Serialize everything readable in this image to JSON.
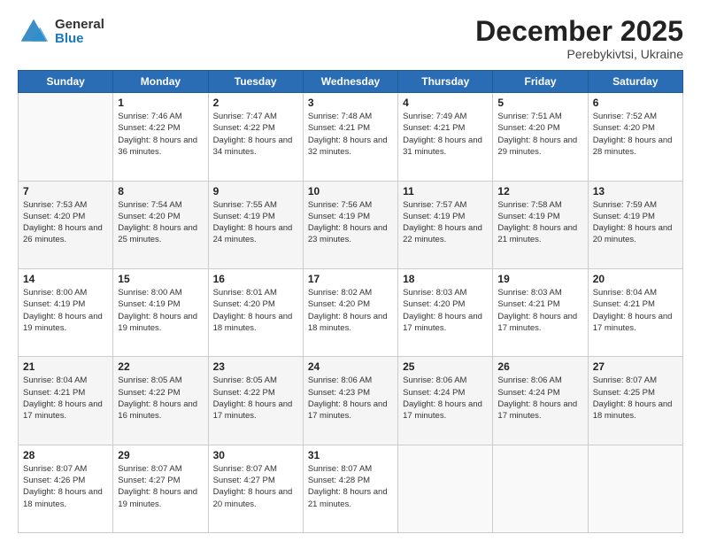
{
  "header": {
    "logo_general": "General",
    "logo_blue": "Blue",
    "month_title": "December 2025",
    "location": "Perebykivtsi, Ukraine"
  },
  "days_of_week": [
    "Sunday",
    "Monday",
    "Tuesday",
    "Wednesday",
    "Thursday",
    "Friday",
    "Saturday"
  ],
  "weeks": [
    [
      {
        "day": "",
        "empty": true
      },
      {
        "day": "1",
        "sunrise": "7:46 AM",
        "sunset": "4:22 PM",
        "daylight": "8 hours and 36 minutes."
      },
      {
        "day": "2",
        "sunrise": "7:47 AM",
        "sunset": "4:22 PM",
        "daylight": "8 hours and 34 minutes."
      },
      {
        "day": "3",
        "sunrise": "7:48 AM",
        "sunset": "4:21 PM",
        "daylight": "8 hours and 32 minutes."
      },
      {
        "day": "4",
        "sunrise": "7:49 AM",
        "sunset": "4:21 PM",
        "daylight": "8 hours and 31 minutes."
      },
      {
        "day": "5",
        "sunrise": "7:51 AM",
        "sunset": "4:20 PM",
        "daylight": "8 hours and 29 minutes."
      },
      {
        "day": "6",
        "sunrise": "7:52 AM",
        "sunset": "4:20 PM",
        "daylight": "8 hours and 28 minutes."
      }
    ],
    [
      {
        "day": "7",
        "sunrise": "7:53 AM",
        "sunset": "4:20 PM",
        "daylight": "8 hours and 26 minutes."
      },
      {
        "day": "8",
        "sunrise": "7:54 AM",
        "sunset": "4:20 PM",
        "daylight": "8 hours and 25 minutes."
      },
      {
        "day": "9",
        "sunrise": "7:55 AM",
        "sunset": "4:19 PM",
        "daylight": "8 hours and 24 minutes."
      },
      {
        "day": "10",
        "sunrise": "7:56 AM",
        "sunset": "4:19 PM",
        "daylight": "8 hours and 23 minutes."
      },
      {
        "day": "11",
        "sunrise": "7:57 AM",
        "sunset": "4:19 PM",
        "daylight": "8 hours and 22 minutes."
      },
      {
        "day": "12",
        "sunrise": "7:58 AM",
        "sunset": "4:19 PM",
        "daylight": "8 hours and 21 minutes."
      },
      {
        "day": "13",
        "sunrise": "7:59 AM",
        "sunset": "4:19 PM",
        "daylight": "8 hours and 20 minutes."
      }
    ],
    [
      {
        "day": "14",
        "sunrise": "8:00 AM",
        "sunset": "4:19 PM",
        "daylight": "8 hours and 19 minutes."
      },
      {
        "day": "15",
        "sunrise": "8:00 AM",
        "sunset": "4:19 PM",
        "daylight": "8 hours and 19 minutes."
      },
      {
        "day": "16",
        "sunrise": "8:01 AM",
        "sunset": "4:20 PM",
        "daylight": "8 hours and 18 minutes."
      },
      {
        "day": "17",
        "sunrise": "8:02 AM",
        "sunset": "4:20 PM",
        "daylight": "8 hours and 18 minutes."
      },
      {
        "day": "18",
        "sunrise": "8:03 AM",
        "sunset": "4:20 PM",
        "daylight": "8 hours and 17 minutes."
      },
      {
        "day": "19",
        "sunrise": "8:03 AM",
        "sunset": "4:21 PM",
        "daylight": "8 hours and 17 minutes."
      },
      {
        "day": "20",
        "sunrise": "8:04 AM",
        "sunset": "4:21 PM",
        "daylight": "8 hours and 17 minutes."
      }
    ],
    [
      {
        "day": "21",
        "sunrise": "8:04 AM",
        "sunset": "4:21 PM",
        "daylight": "8 hours and 17 minutes."
      },
      {
        "day": "22",
        "sunrise": "8:05 AM",
        "sunset": "4:22 PM",
        "daylight": "8 hours and 16 minutes."
      },
      {
        "day": "23",
        "sunrise": "8:05 AM",
        "sunset": "4:22 PM",
        "daylight": "8 hours and 17 minutes."
      },
      {
        "day": "24",
        "sunrise": "8:06 AM",
        "sunset": "4:23 PM",
        "daylight": "8 hours and 17 minutes."
      },
      {
        "day": "25",
        "sunrise": "8:06 AM",
        "sunset": "4:24 PM",
        "daylight": "8 hours and 17 minutes."
      },
      {
        "day": "26",
        "sunrise": "8:06 AM",
        "sunset": "4:24 PM",
        "daylight": "8 hours and 17 minutes."
      },
      {
        "day": "27",
        "sunrise": "8:07 AM",
        "sunset": "4:25 PM",
        "daylight": "8 hours and 18 minutes."
      }
    ],
    [
      {
        "day": "28",
        "sunrise": "8:07 AM",
        "sunset": "4:26 PM",
        "daylight": "8 hours and 18 minutes."
      },
      {
        "day": "29",
        "sunrise": "8:07 AM",
        "sunset": "4:27 PM",
        "daylight": "8 hours and 19 minutes."
      },
      {
        "day": "30",
        "sunrise": "8:07 AM",
        "sunset": "4:27 PM",
        "daylight": "8 hours and 20 minutes."
      },
      {
        "day": "31",
        "sunrise": "8:07 AM",
        "sunset": "4:28 PM",
        "daylight": "8 hours and 21 minutes."
      },
      {
        "day": "",
        "empty": true
      },
      {
        "day": "",
        "empty": true
      },
      {
        "day": "",
        "empty": true
      }
    ]
  ]
}
